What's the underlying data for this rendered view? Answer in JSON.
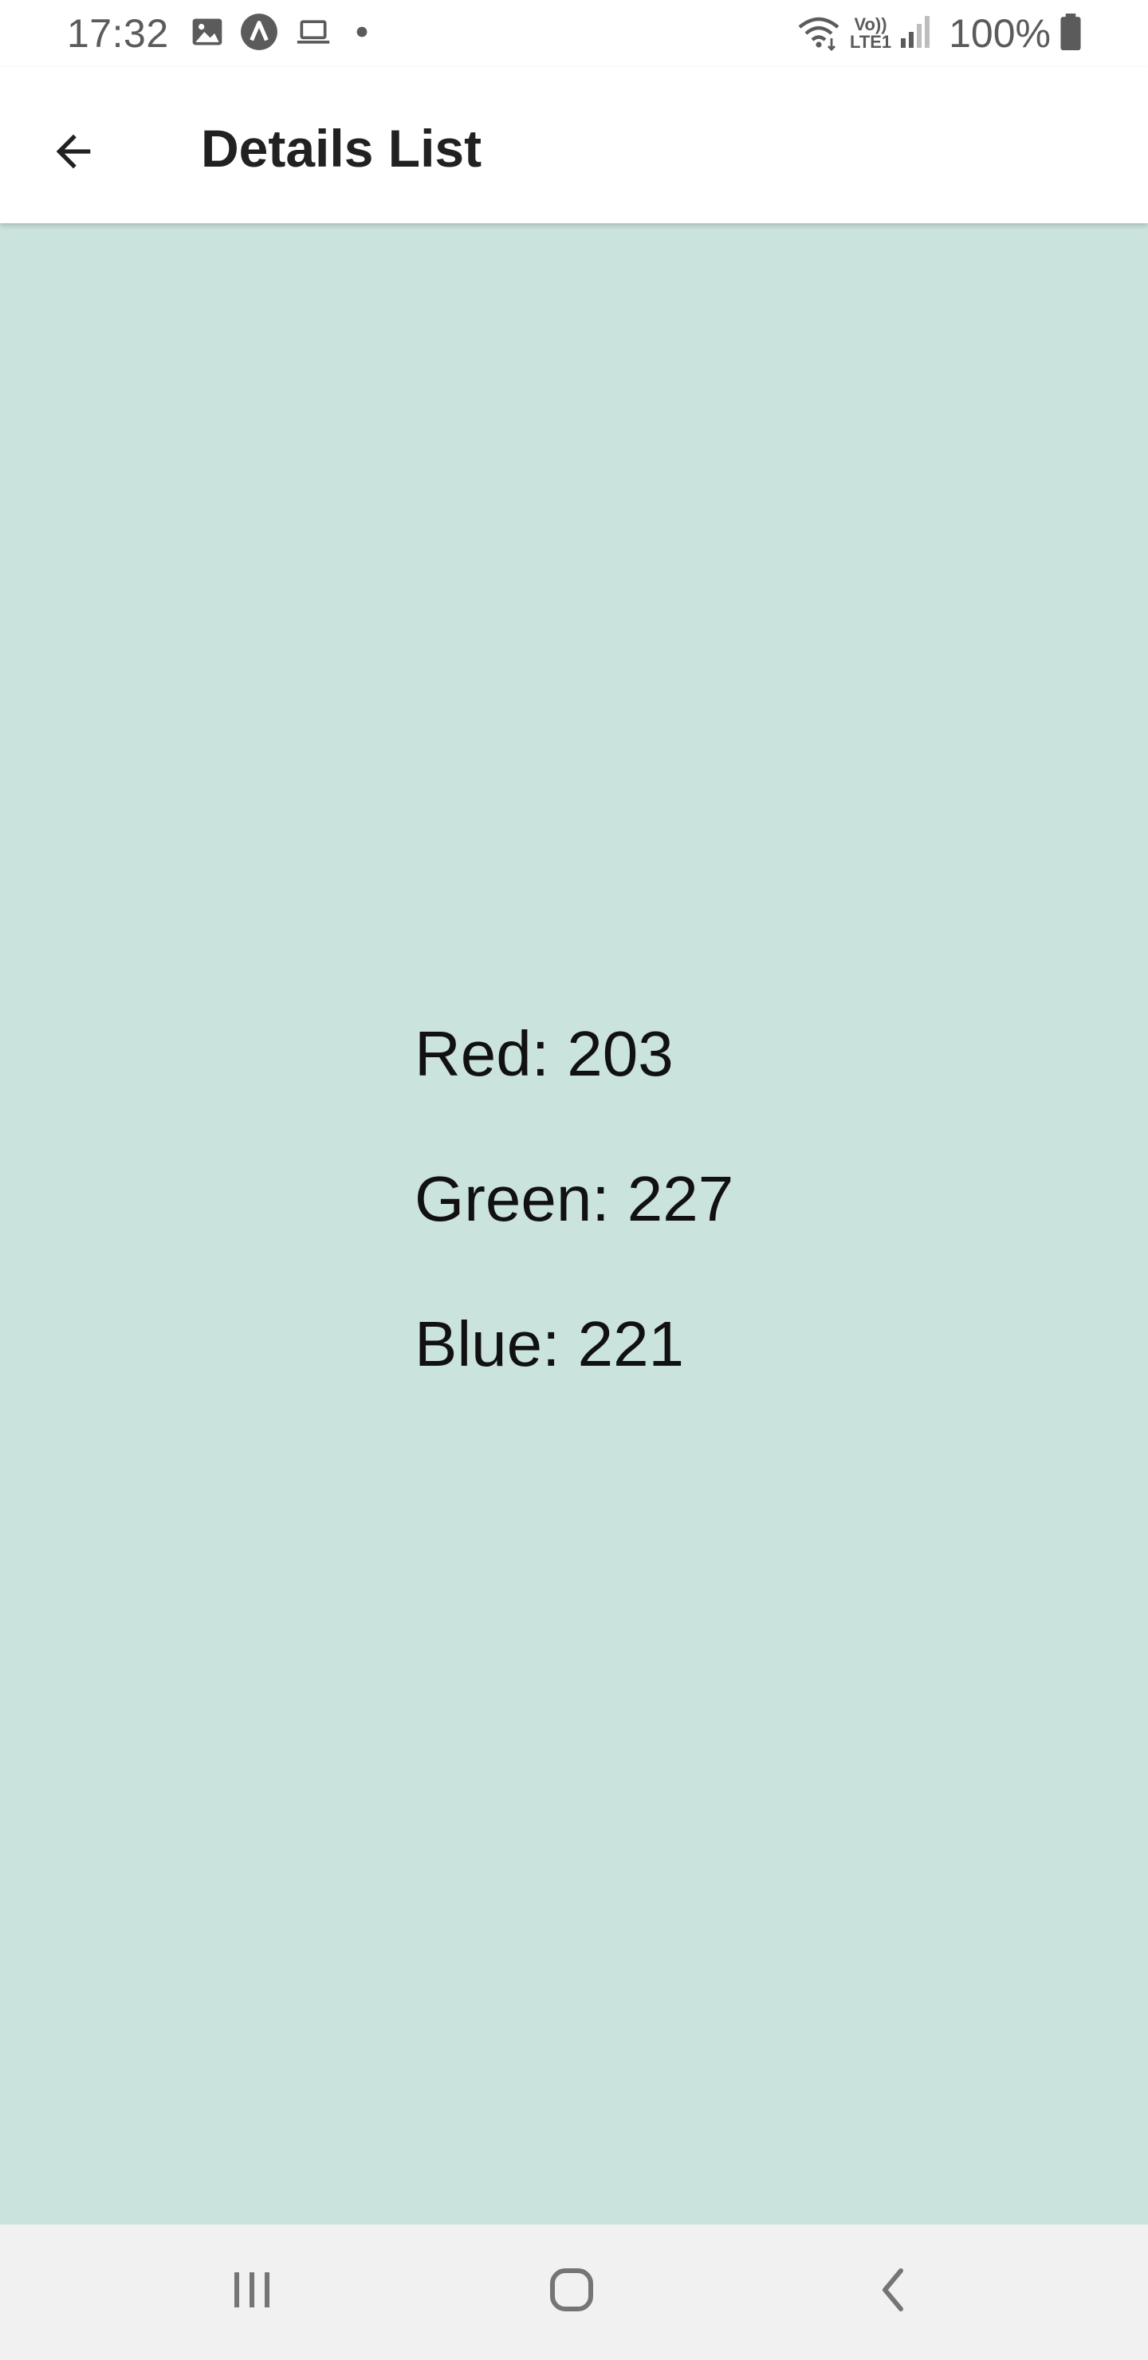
{
  "status_bar": {
    "time": "17:32",
    "battery": "100%",
    "icons": [
      "image-icon",
      "a-circle-icon",
      "laptop-icon",
      "dot-icon",
      "wifi-icon",
      "volte-icon",
      "signal-icon",
      "battery-icon"
    ],
    "network_label_top": "Vo))",
    "network_label_bottom": "LTE1"
  },
  "app_bar": {
    "title": "Details List",
    "back_icon": "arrow-back-icon"
  },
  "content": {
    "background_color": "#cbe3dd",
    "lines": [
      {
        "label": "Red: 203"
      },
      {
        "label": "Green: 227"
      },
      {
        "label": "Blue: 221"
      }
    ]
  },
  "nav_bar": {
    "buttons": [
      "recents-icon",
      "home-icon",
      "back-icon"
    ]
  }
}
